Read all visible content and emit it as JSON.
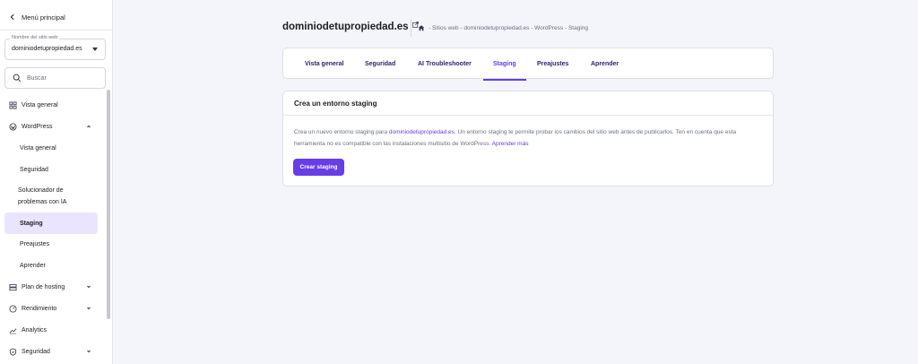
{
  "sidebar": {
    "back_label": "Menú principal",
    "site_select": {
      "label": "Nombre del sitio web",
      "value": "dominiodetupropiedad.es"
    },
    "search_placeholder": "Buscar",
    "items": {
      "vista_general": "Vista general",
      "wordpress": "WordPress",
      "wp_vista_general": "Vista general",
      "wp_seguridad": "Seguridad",
      "wp_solucionador_1": "Solucionador de",
      "wp_solucionador_2": "problemas con IA",
      "wp_staging": "Staging",
      "wp_preajustes": "Preajustes",
      "wp_aprender": "Aprender",
      "plan_hosting": "Plan de hosting",
      "rendimiento": "Rendimiento",
      "analytics": "Analytics",
      "seguridad": "Seguridad"
    }
  },
  "header": {
    "domain": "dominiodetupropiedad.es",
    "breadcrumb": "- Sitios web - dominiodetupropiedad.es - WordPress - Staging"
  },
  "tabs": [
    "Vista general",
    "Seguridad",
    "AI Troubleshooter",
    "Staging",
    "Preajustes",
    "Aprender"
  ],
  "active_tab": "Staging",
  "card": {
    "title": "Crea un entorno staging",
    "desc_1": "Crea un nuevo entorno staging para ",
    "desc_link": "dominiodetupropiedad.es",
    "desc_2": ". Un entorno staging te permite probar los cambios del sitio web antes de publicarlos. Ten en cuenta que esta herramienta no es compatible con las instalaciones multisitio de WordPress. ",
    "learn_more": "Aprender más",
    "button": "Crear staging"
  },
  "colors": {
    "accent": "#673de6",
    "active_bg": "#ebe4ff",
    "page_bg": "#f4f4fb"
  }
}
